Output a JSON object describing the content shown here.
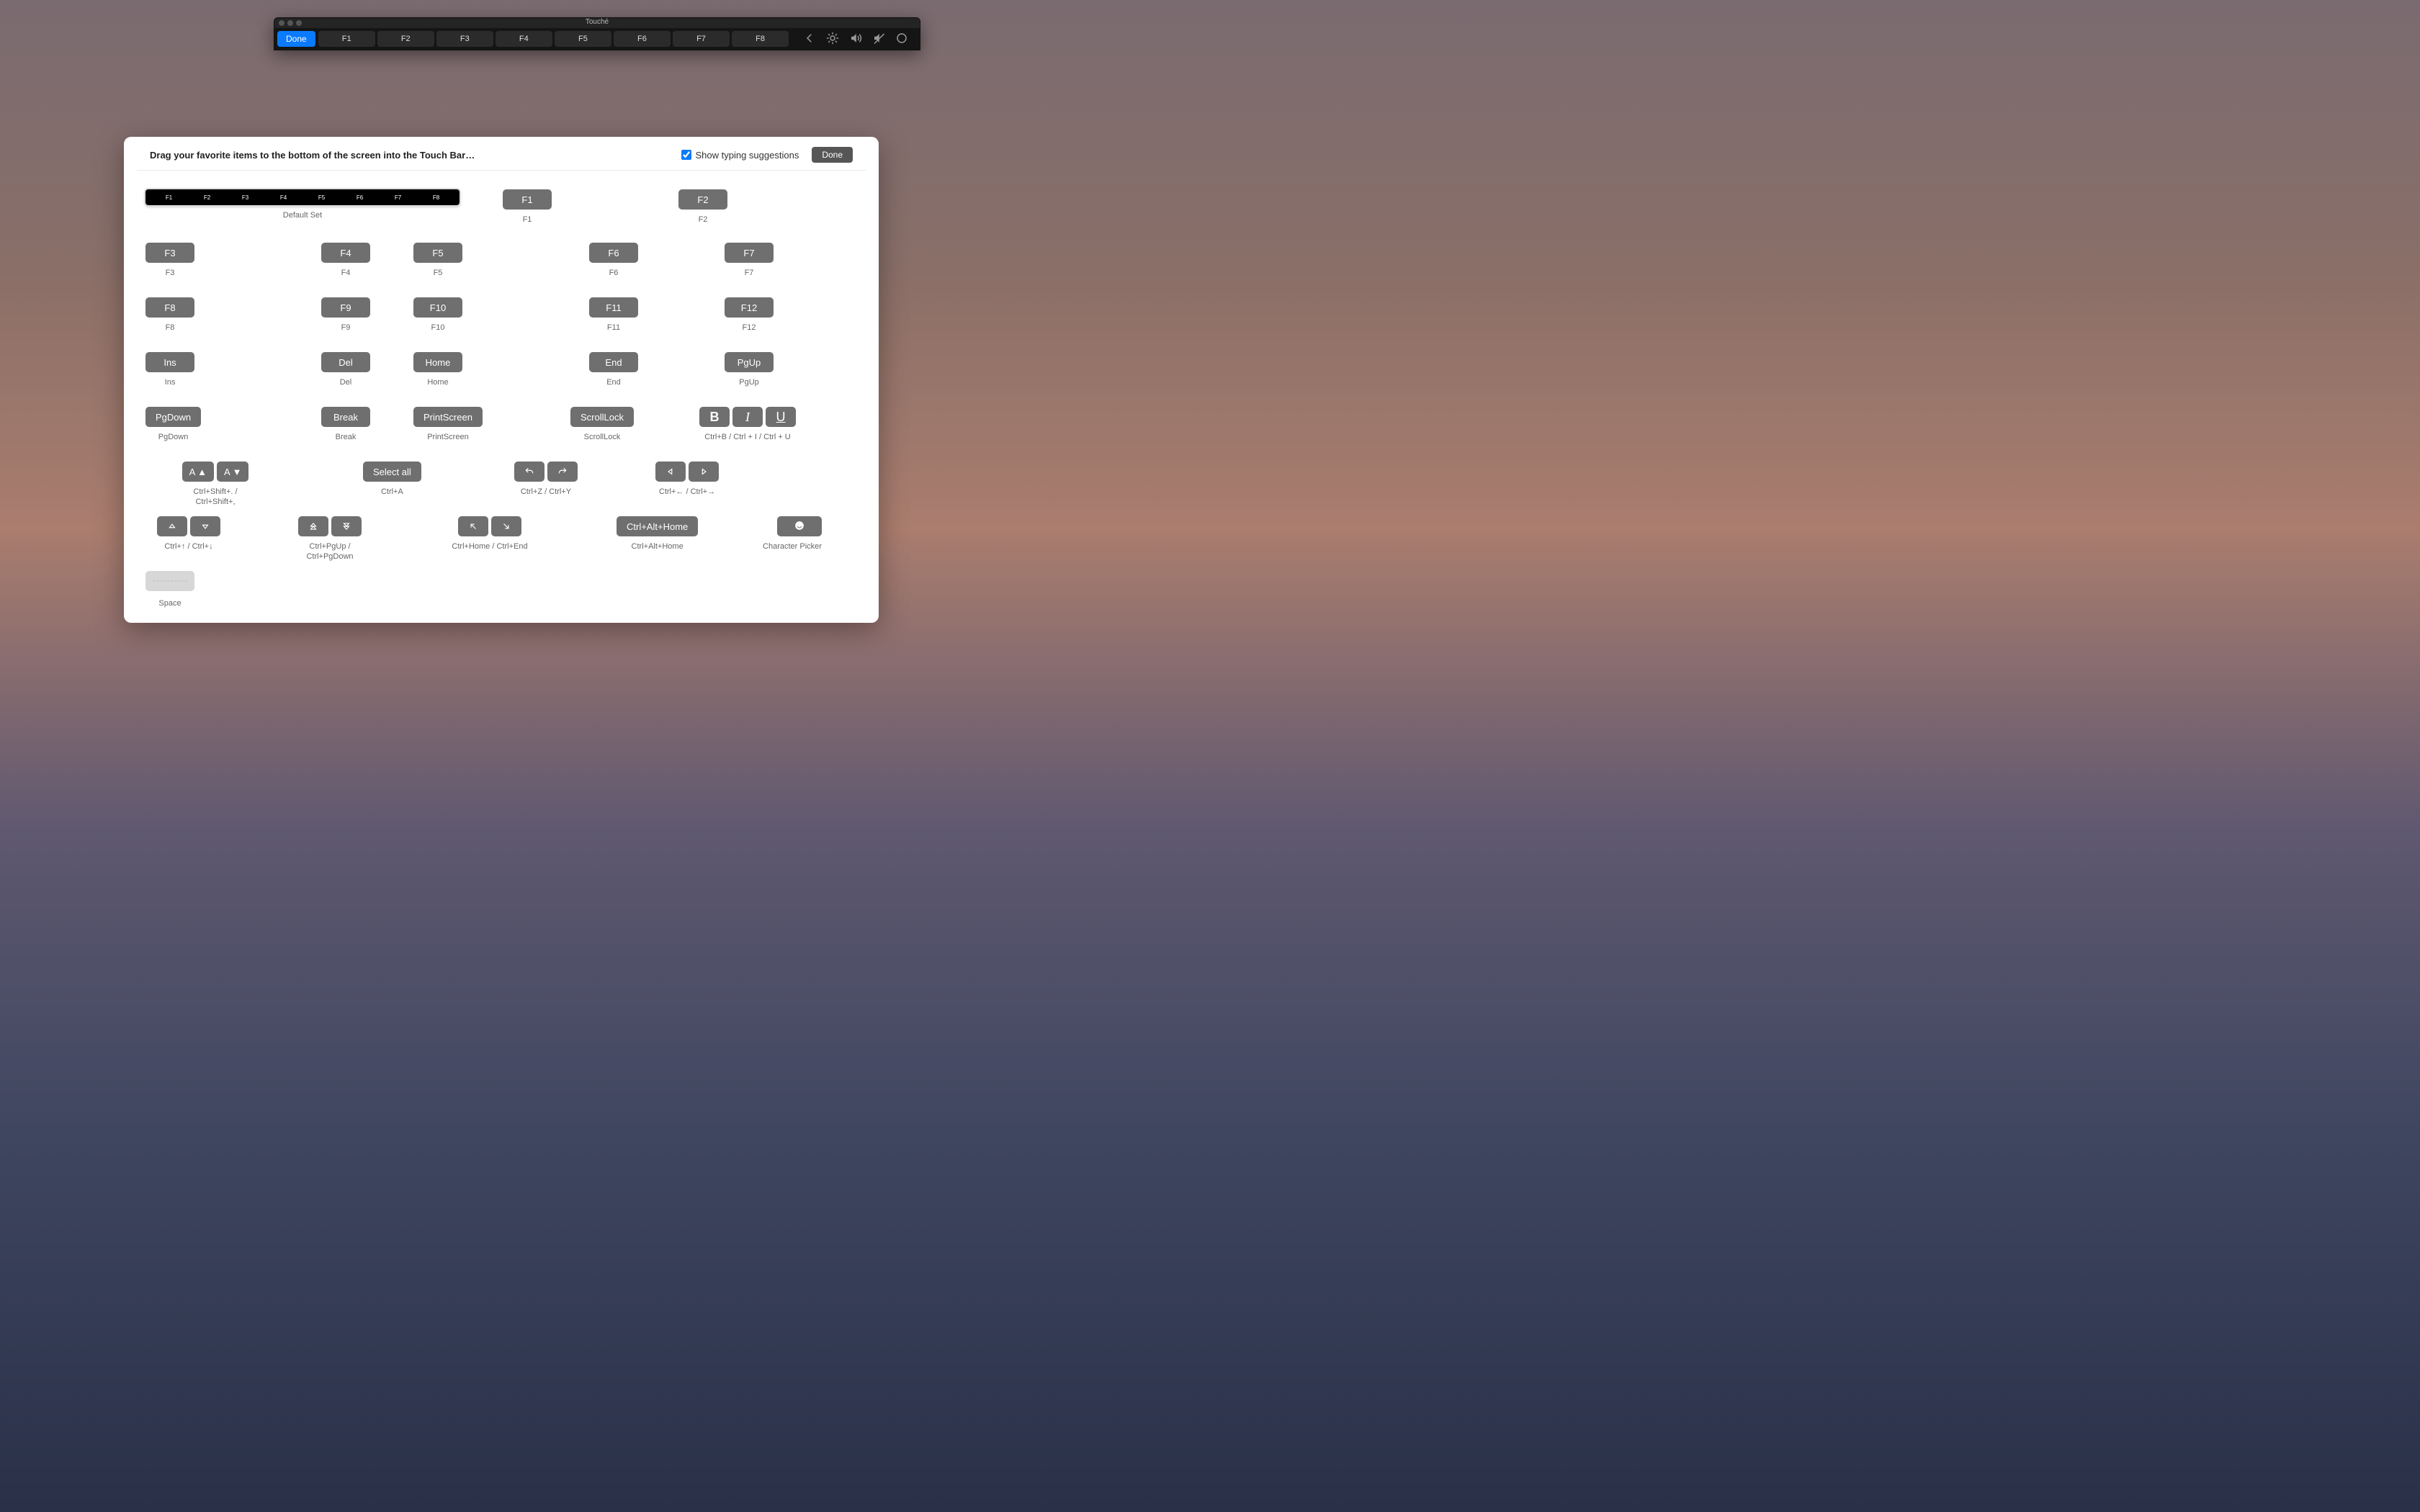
{
  "touche": {
    "window_title": "Touché",
    "touchbar": {
      "done_label": "Done",
      "fkeys": [
        "F1",
        "F2",
        "F3",
        "F4",
        "F5",
        "F6",
        "F7",
        "F8"
      ],
      "ctrl_strip_icons": [
        "chevron-left",
        "brightness",
        "volume",
        "mute",
        "siri"
      ]
    }
  },
  "panel": {
    "instruction": "Drag your favorite items to the bottom of the screen into the Touch Bar…",
    "show_typing_label": "Show typing suggestions",
    "show_typing_checked": true,
    "done_button": "Done",
    "default_set": {
      "caption": "Default Set",
      "keys": [
        "F1",
        "F2",
        "F3",
        "F4",
        "F5",
        "F6",
        "F7",
        "F8"
      ]
    },
    "items": {
      "f1": {
        "chip": "F1",
        "caption": "F1"
      },
      "f2": {
        "chip": "F2",
        "caption": "F2"
      },
      "f3": {
        "chip": "F3",
        "caption": "F3"
      },
      "f4": {
        "chip": "F4",
        "caption": "F4"
      },
      "f5": {
        "chip": "F5",
        "caption": "F5"
      },
      "f6": {
        "chip": "F6",
        "caption": "F6"
      },
      "f7": {
        "chip": "F7",
        "caption": "F7"
      },
      "f8": {
        "chip": "F8",
        "caption": "F8"
      },
      "f9": {
        "chip": "F9",
        "caption": "F9"
      },
      "f10": {
        "chip": "F10",
        "caption": "F10"
      },
      "f11": {
        "chip": "F11",
        "caption": "F11"
      },
      "f12": {
        "chip": "F12",
        "caption": "F12"
      },
      "ins": {
        "chip": "Ins",
        "caption": "Ins"
      },
      "del": {
        "chip": "Del",
        "caption": "Del"
      },
      "home": {
        "chip": "Home",
        "caption": "Home"
      },
      "end": {
        "chip": "End",
        "caption": "End"
      },
      "pgup": {
        "chip": "PgUp",
        "caption": "PgUp"
      },
      "pgdown": {
        "chip": "PgDown",
        "caption": "PgDown"
      },
      "break": {
        "chip": "Break",
        "caption": "Break"
      },
      "printscreen": {
        "chip": "PrintScreen",
        "caption": "PrintScreen"
      },
      "scrolllock": {
        "chip": "ScrollLock",
        "caption": "ScrollLock"
      },
      "biu": {
        "chips": [
          "B",
          "I",
          "U"
        ],
        "caption": "Ctrl+B / Ctrl + I / Ctrl + U"
      },
      "fontsize": {
        "chips": [
          "A ▲",
          "A ▼"
        ],
        "caption": "Ctrl+Shift+. / Ctrl+Shift+,"
      },
      "selectall": {
        "chip": "Select all",
        "caption": "Ctrl+A"
      },
      "undoredo": {
        "icons": [
          "undo",
          "redo"
        ],
        "caption": "Ctrl+Z / Ctrl+Y"
      },
      "wordnav": {
        "icons": [
          "tri-left",
          "tri-right"
        ],
        "caption": "Ctrl+← / Ctrl+→"
      },
      "linenav": {
        "icons": [
          "tri-up",
          "tri-down"
        ],
        "caption": "Ctrl+↑ / Ctrl+↓"
      },
      "pagenav": {
        "icons": [
          "dbl-up",
          "dbl-down"
        ],
        "caption": "Ctrl+PgUp / Ctrl+PgDown"
      },
      "homend": {
        "icons": [
          "arrow-nw",
          "arrow-se"
        ],
        "caption": "Ctrl+Home / Ctrl+End"
      },
      "ctrlalthome": {
        "chip": "Ctrl+Alt+Home",
        "caption": "Ctrl+Alt+Home"
      },
      "charpicker": {
        "icon": "smile",
        "caption": "Character Picker"
      },
      "space": {
        "caption": "Space"
      }
    }
  }
}
